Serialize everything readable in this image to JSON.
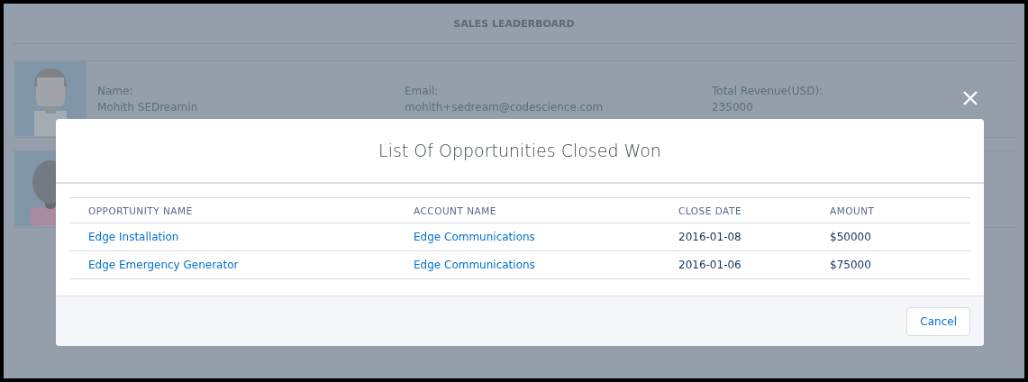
{
  "page": {
    "title": "SALES LEADERBOARD"
  },
  "leaders": [
    {
      "kind": "man",
      "fields": [
        {
          "label": "Name:",
          "value": "Mohith SEDreamin"
        },
        {
          "label": "Email:",
          "value": "mohith+sedream@codescience.com"
        },
        {
          "label": "Total Revenue(USD):",
          "value": "235000"
        }
      ]
    },
    {
      "kind": "woman"
    }
  ],
  "modal": {
    "title": "List Of Opportunities Closed Won",
    "columns": [
      "OPPORTUNITY NAME",
      "ACCOUNT NAME",
      "CLOSE DATE",
      "AMOUNT"
    ],
    "rows": [
      [
        "Edge Installation",
        "Edge Communications",
        "2016-01-08",
        "$50000"
      ],
      [
        "Edge Emergency Generator",
        "Edge Communications",
        "2016-01-06",
        "$75000"
      ]
    ],
    "buttons": [
      "Cancel"
    ]
  }
}
